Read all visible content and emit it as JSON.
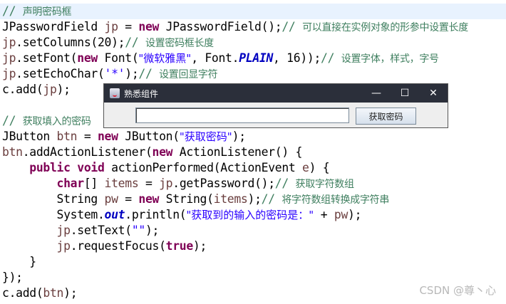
{
  "code_lines": [
    [
      [
        "c",
        "// 声明密码框"
      ]
    ],
    [
      [
        "p",
        "JPasswordField "
      ],
      [
        "v",
        "jp"
      ],
      [
        "p",
        " = "
      ],
      [
        "k",
        "new"
      ],
      [
        "p",
        " JPasswordField();"
      ],
      [
        "c",
        "// 可以直接在实例对象的形参中设置长度"
      ]
    ],
    [
      [
        "v",
        "jp"
      ],
      [
        "p",
        ".setColumns(20);"
      ],
      [
        "c",
        "// 设置密码框长度"
      ]
    ],
    [
      [
        "v",
        "jp"
      ],
      [
        "p",
        ".setFont("
      ],
      [
        "k",
        "new"
      ],
      [
        "p",
        " Font("
      ],
      [
        "s",
        "\"微软雅黑\""
      ],
      [
        "p",
        ", Font."
      ],
      [
        "f",
        "PLAIN"
      ],
      [
        "p",
        ", 16));"
      ],
      [
        "c",
        "// 设置字体，样式，字号"
      ]
    ],
    [
      [
        "v",
        "jp"
      ],
      [
        "p",
        ".setEchoChar("
      ],
      [
        "s",
        "'*'"
      ],
      [
        "p",
        ");"
      ],
      [
        "c",
        "// 设置回显字符"
      ]
    ],
    [
      [
        "p",
        "c.add("
      ],
      [
        "v",
        "jp"
      ],
      [
        "p",
        ");"
      ]
    ],
    [],
    [
      [
        "c",
        "// 获取填入的密码"
      ]
    ],
    [
      [
        "p",
        "JButton "
      ],
      [
        "v",
        "btn"
      ],
      [
        "p",
        " = "
      ],
      [
        "k",
        "new"
      ],
      [
        "p",
        " JButton("
      ],
      [
        "s",
        "\"获取密码\""
      ],
      [
        "p",
        ");"
      ]
    ],
    [
      [
        "v",
        "btn"
      ],
      [
        "p",
        ".addActionListener("
      ],
      [
        "k",
        "new"
      ],
      [
        "p",
        " ActionListener() {"
      ]
    ],
    [
      [
        "p",
        "    "
      ],
      [
        "k",
        "public"
      ],
      [
        "p",
        " "
      ],
      [
        "k",
        "void"
      ],
      [
        "p",
        " actionPerformed(ActionEvent "
      ],
      [
        "v",
        "e"
      ],
      [
        "p",
        ") {"
      ]
    ],
    [
      [
        "p",
        "        "
      ],
      [
        "k",
        "char"
      ],
      [
        "p",
        "[] "
      ],
      [
        "v",
        "items"
      ],
      [
        "p",
        " = "
      ],
      [
        "v",
        "jp"
      ],
      [
        "p",
        ".getPassword();"
      ],
      [
        "c",
        "// 获取字符数组"
      ]
    ],
    [
      [
        "p",
        "        String "
      ],
      [
        "v",
        "pw"
      ],
      [
        "p",
        " = "
      ],
      [
        "k",
        "new"
      ],
      [
        "p",
        " String("
      ],
      [
        "v",
        "items"
      ],
      [
        "p",
        ");"
      ],
      [
        "c",
        "// 将字符数组转换成字符串"
      ]
    ],
    [
      [
        "p",
        "        System."
      ],
      [
        "f",
        "out"
      ],
      [
        "p",
        ".println("
      ],
      [
        "s",
        "\"获取到的输入的密码是：\""
      ],
      [
        "p",
        " + "
      ],
      [
        "v",
        "pw"
      ],
      [
        "p",
        ");"
      ]
    ],
    [
      [
        "p",
        "        "
      ],
      [
        "v",
        "jp"
      ],
      [
        "p",
        ".setText("
      ],
      [
        "s",
        "\"\""
      ],
      [
        "p",
        ");"
      ]
    ],
    [
      [
        "p",
        "        "
      ],
      [
        "v",
        "jp"
      ],
      [
        "p",
        ".requestFocus("
      ],
      [
        "k",
        "true"
      ],
      [
        "p",
        ");"
      ]
    ],
    [
      [
        "p",
        "    }"
      ]
    ],
    [
      [
        "p",
        "});"
      ]
    ],
    [
      [
        "p",
        "c.add("
      ],
      [
        "v",
        "btn"
      ],
      [
        "p",
        ");"
      ]
    ]
  ],
  "window": {
    "title": "熟悉组件",
    "minimize": "—",
    "maximize": "☐",
    "close": "✕",
    "password_value": "",
    "button_label": "获取密码"
  },
  "watermark": "CSDN @尊丶心"
}
